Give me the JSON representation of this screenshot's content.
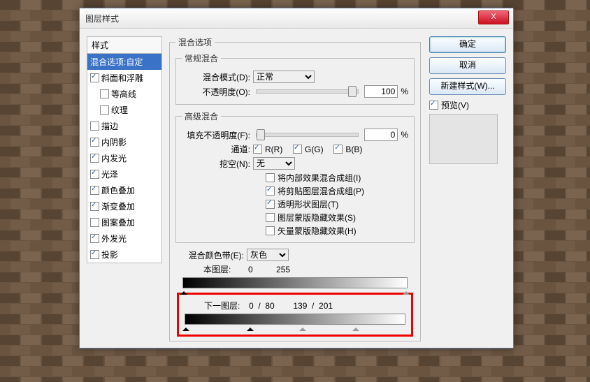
{
  "title": "图层样式",
  "close": "X",
  "styles_header": "样式",
  "styles": [
    {
      "label": "混合选项:自定",
      "selected": true,
      "checked": null
    },
    {
      "label": "斜面和浮雕",
      "checked": true
    },
    {
      "label": "等高线",
      "checked": false,
      "indent": true
    },
    {
      "label": "纹理",
      "checked": false,
      "indent": true
    },
    {
      "label": "描边",
      "checked": false
    },
    {
      "label": "内阴影",
      "checked": true
    },
    {
      "label": "内发光",
      "checked": true
    },
    {
      "label": "光泽",
      "checked": true
    },
    {
      "label": "颜色叠加",
      "checked": true
    },
    {
      "label": "渐变叠加",
      "checked": true
    },
    {
      "label": "图案叠加",
      "checked": false
    },
    {
      "label": "外发光",
      "checked": true
    },
    {
      "label": "投影",
      "checked": true
    }
  ],
  "blend_options": "混合选项",
  "general": "常规混合",
  "blend_mode_label": "混合模式(D):",
  "blend_mode_value": "正常",
  "opacity_label": "不透明度(O):",
  "opacity_value": "100",
  "percent": "%",
  "advanced": "高级混合",
  "fill_label": "填充不透明度(F):",
  "fill_value": "0",
  "channels_label": "通道:",
  "ch_r": "R(R)",
  "ch_g": "G(G)",
  "ch_b": "B(B)",
  "knockout_label": "挖空(N):",
  "knockout_value": "无",
  "adv": [
    {
      "label": "将内部效果混合成组(I)",
      "on": false
    },
    {
      "label": "将剪贴图层混合成组(P)",
      "on": true
    },
    {
      "label": "透明形状图层(T)",
      "on": true
    },
    {
      "label": "图层蒙版隐藏效果(S)",
      "on": false
    },
    {
      "label": "矢量蒙版隐藏效果(H)",
      "on": false
    }
  ],
  "blendif_label": "混合颜色带(E):",
  "blendif_value": "灰色",
  "this_layer_label": "本图层:",
  "this_layer_vals": "0          255",
  "under_label": "下一图层:",
  "under_vals": "0  /  80        139  /  201",
  "btn_ok": "确定",
  "btn_cancel": "取消",
  "btn_newstyle": "新建样式(W)...",
  "preview_label": "预览(V)"
}
